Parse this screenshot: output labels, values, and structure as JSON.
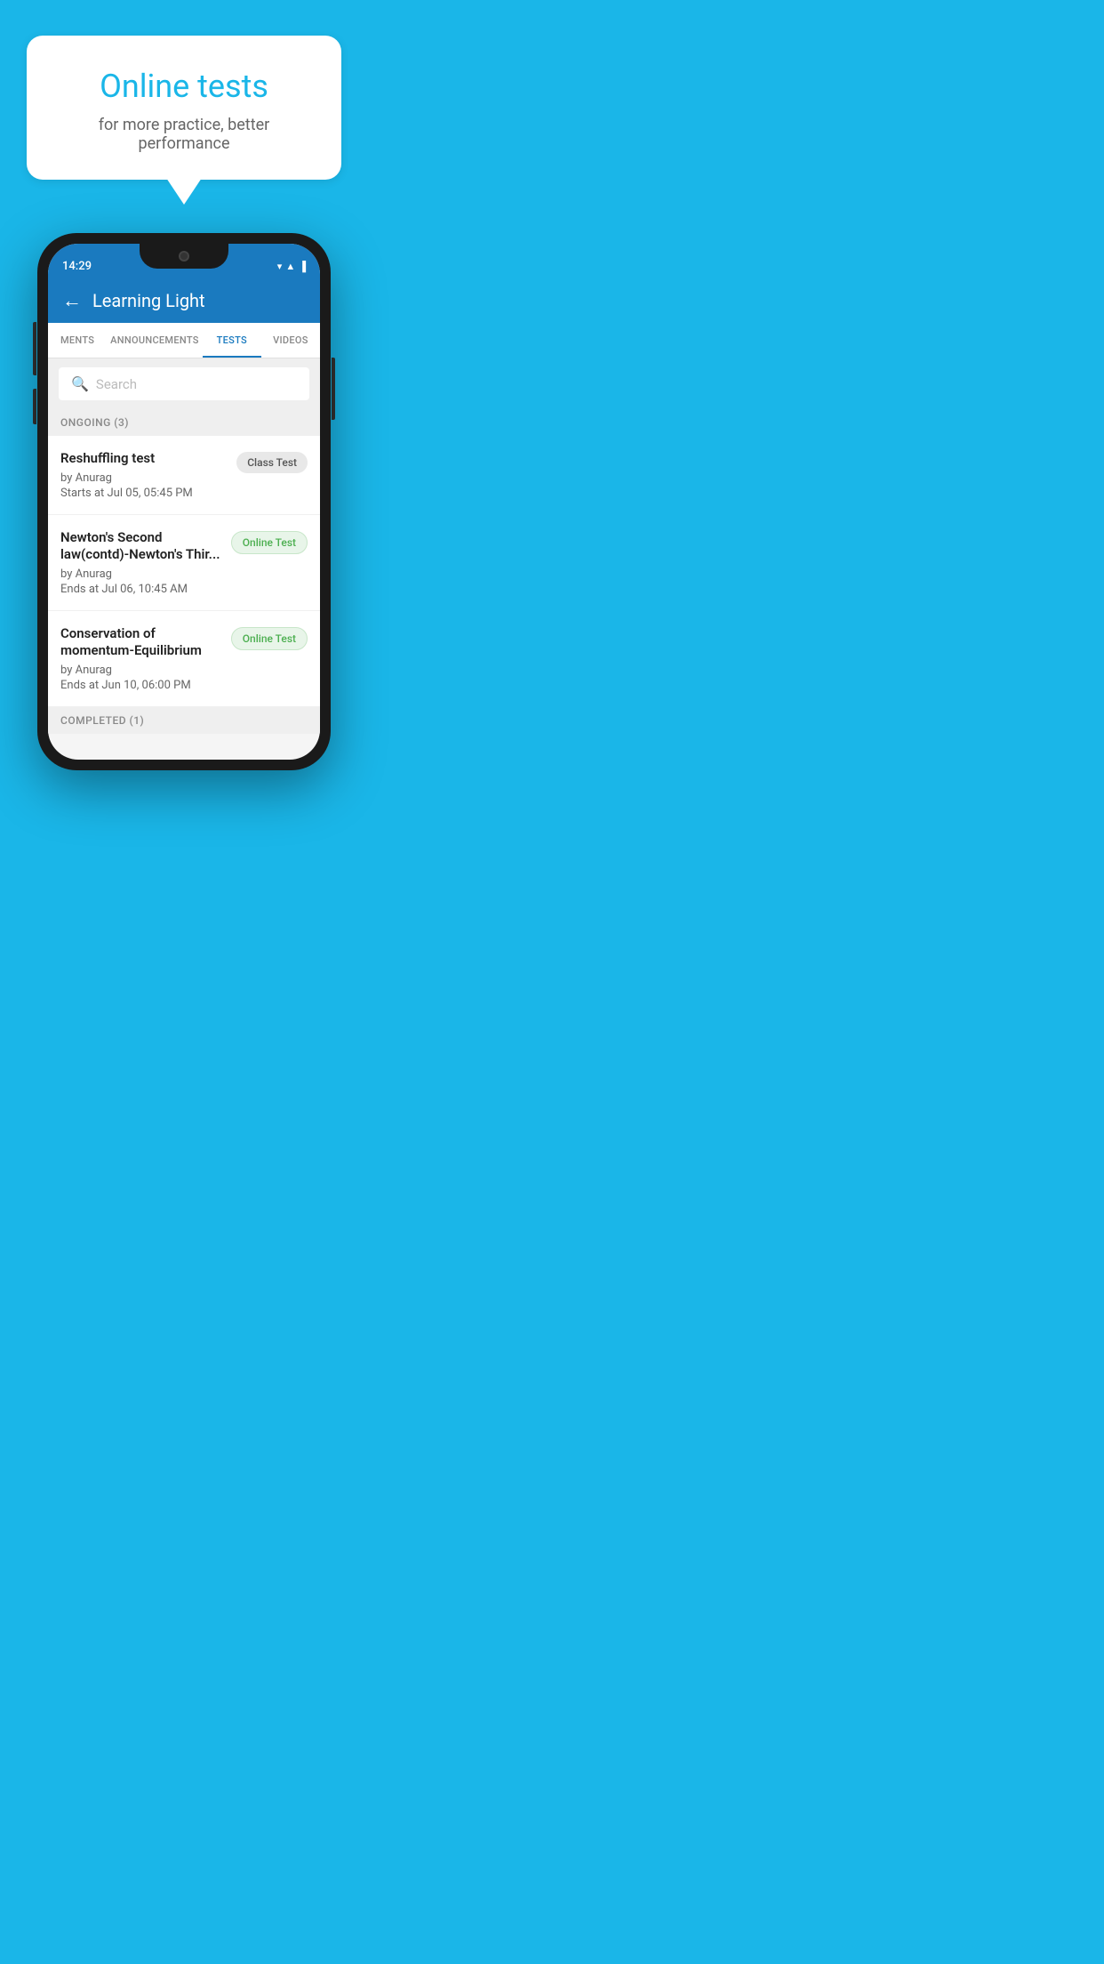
{
  "background": {
    "color": "#1ab6e8"
  },
  "hero": {
    "bubble_title": "Online tests",
    "bubble_subtitle": "for more practice, better performance"
  },
  "phone": {
    "status_bar": {
      "time": "14:29",
      "wifi_icon": "▾",
      "signal_icon": "▲",
      "battery_icon": "▐"
    },
    "header": {
      "back_label": "←",
      "title": "Learning Light"
    },
    "tabs": [
      {
        "label": "MENTS",
        "active": false
      },
      {
        "label": "ANNOUNCEMENTS",
        "active": false
      },
      {
        "label": "TESTS",
        "active": true
      },
      {
        "label": "VIDEOS",
        "active": false
      }
    ],
    "search": {
      "placeholder": "Search"
    },
    "ongoing_section": {
      "header": "ONGOING (3)",
      "items": [
        {
          "name": "Reshuffling test",
          "by": "by Anurag",
          "date": "Starts at  Jul 05, 05:45 PM",
          "badge": "Class Test",
          "badge_type": "class"
        },
        {
          "name": "Newton's Second law(contd)-Newton's Thir...",
          "by": "by Anurag",
          "date": "Ends at  Jul 06, 10:45 AM",
          "badge": "Online Test",
          "badge_type": "online"
        },
        {
          "name": "Conservation of momentum-Equilibrium",
          "by": "by Anurag",
          "date": "Ends at  Jun 10, 06:00 PM",
          "badge": "Online Test",
          "badge_type": "online"
        }
      ]
    },
    "completed_section": {
      "header": "COMPLETED (1)"
    }
  }
}
